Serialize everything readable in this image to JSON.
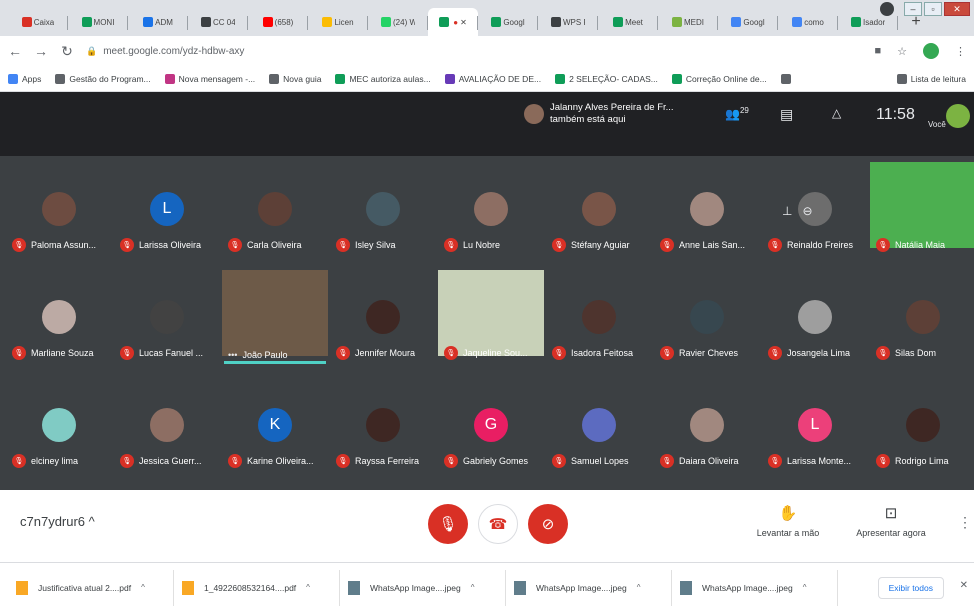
{
  "browser": {
    "tabs": [
      {
        "label": "Caixa",
        "color": "#d93025"
      },
      {
        "label": "MONI",
        "color": "#0f9d58"
      },
      {
        "label": "ADM",
        "color": "#1a73e8"
      },
      {
        "label": "CC 04",
        "color": "#3c4043"
      },
      {
        "label": "(658)",
        "color": "#ff0000"
      },
      {
        "label": "Licen",
        "color": "#fbbc04"
      },
      {
        "label": "(24) W",
        "color": "#25d366"
      },
      {
        "label": "",
        "color": "#0f9d58",
        "active": true
      },
      {
        "label": "Googl",
        "color": "#0f9d58"
      },
      {
        "label": "WPS F",
        "color": "#3c4043"
      },
      {
        "label": "Meet",
        "color": "#0f9d58"
      },
      {
        "label": "MEDI",
        "color": "#7cb342"
      },
      {
        "label": "Googl",
        "color": "#4285f4"
      },
      {
        "label": "como",
        "color": "#4285f4"
      },
      {
        "label": "Isador",
        "color": "#0f9d58"
      }
    ],
    "new_tab": "+",
    "url": "meet.google.com/ydz-hdbw-axy",
    "bookmarks": [
      {
        "label": "Apps",
        "color": "#4285f4"
      },
      {
        "label": "Gestão do Program...",
        "color": "#5f6368"
      },
      {
        "label": "Nova mensagem -...",
        "color": "#c13584"
      },
      {
        "label": "Nova guia",
        "color": "#5f6368"
      },
      {
        "label": "MEC autoriza aulas...",
        "color": "#0f9d58"
      },
      {
        "label": "AVALIAÇÃO DE DE...",
        "color": "#673ab7"
      },
      {
        "label": "2 SELEÇÃO- CADAS...",
        "color": "#0f9d58"
      },
      {
        "label": "Correção Online de...",
        "color": "#0f9d58"
      },
      {
        "label": "",
        "color": "#5f6368"
      }
    ],
    "reading_list": "Lista de leitura"
  },
  "meet": {
    "notification": {
      "line1": "Jalanny Alves Pereira de Fr...",
      "line2": "também está aqui"
    },
    "participants_count": "29",
    "clock": "11:58",
    "you_label": "Você",
    "meeting_code": "c7n7ydrur6",
    "raise_hand": "Levantar a mão",
    "present_now": "Apresentar agora"
  },
  "participants": [
    {
      "name": "Paloma Assun...",
      "avatar": "photo",
      "color": "#6d4c41"
    },
    {
      "name": "Larissa Oliveira",
      "avatar": "L",
      "color": "#1565c0"
    },
    {
      "name": "Carla Oliveira",
      "avatar": "photo",
      "color": "#5d4037"
    },
    {
      "name": "Isley Silva",
      "avatar": "photo",
      "color": "#455a64"
    },
    {
      "name": "Lu Nobre",
      "avatar": "photo",
      "color": "#8d6e63"
    },
    {
      "name": "Stéfany Aguiar",
      "avatar": "photo",
      "color": "#795548"
    },
    {
      "name": "Anne Lais San...",
      "avatar": "photo",
      "color": "#a1887f"
    },
    {
      "name": "Reinaldo Freires",
      "avatar": "photo",
      "color": "#6d6d6d"
    },
    {
      "name": "Natália Maia",
      "avatar": "video",
      "color": "#4caf50"
    },
    {
      "name": "Marliane Souza",
      "avatar": "photo",
      "color": "#bcaaa4"
    },
    {
      "name": "Lucas Fanuel ...",
      "avatar": "photo",
      "color": "#424242"
    },
    {
      "name": "João Paulo",
      "avatar": "video",
      "color": "#6d5a48",
      "speaking": true
    },
    {
      "name": "Jennifer Moura",
      "avatar": "photo",
      "color": "#3e2723"
    },
    {
      "name": "Jaqueline Sou...",
      "avatar": "video",
      "color": "#c8d1b8"
    },
    {
      "name": "Isadora Feitosa",
      "avatar": "photo",
      "color": "#4e342e"
    },
    {
      "name": "Ravier Cheves",
      "avatar": "photo",
      "color": "#37474f"
    },
    {
      "name": "Josangela Lima",
      "avatar": "photo",
      "color": "#9e9e9e"
    },
    {
      "name": "Silas Dom",
      "avatar": "photo",
      "color": "#5d4037"
    },
    {
      "name": "elciney lima",
      "avatar": "photo",
      "color": "#80cbc4"
    },
    {
      "name": "Jessica Guerr...",
      "avatar": "photo",
      "color": "#8d6e63"
    },
    {
      "name": "Karine Oliveira...",
      "avatar": "K",
      "color": "#1565c0"
    },
    {
      "name": "Rayssa Ferreira",
      "avatar": "photo",
      "color": "#3e2723"
    },
    {
      "name": "Gabriely Gomes",
      "avatar": "G",
      "color": "#e91e63"
    },
    {
      "name": "Samuel Lopes",
      "avatar": "photo",
      "color": "#5c6bc0"
    },
    {
      "name": "Daiara Oliveira",
      "avatar": "photo",
      "color": "#a1887f"
    },
    {
      "name": "Larissa Monte...",
      "avatar": "L",
      "color": "#ec407a"
    },
    {
      "name": "Rodrigo Lima",
      "avatar": "photo",
      "color": "#3e2723"
    }
  ],
  "downloads": [
    {
      "name": "Justificativa atual 2....pdf",
      "color": "#f9a825"
    },
    {
      "name": "1_4922608532164....pdf",
      "color": "#f9a825"
    },
    {
      "name": "WhatsApp Image....jpeg",
      "color": "#607d8b"
    },
    {
      "name": "WhatsApp Image....jpeg",
      "color": "#607d8b"
    },
    {
      "name": "WhatsApp Image....jpeg",
      "color": "#607d8b"
    }
  ],
  "show_all": "Exibir todos"
}
